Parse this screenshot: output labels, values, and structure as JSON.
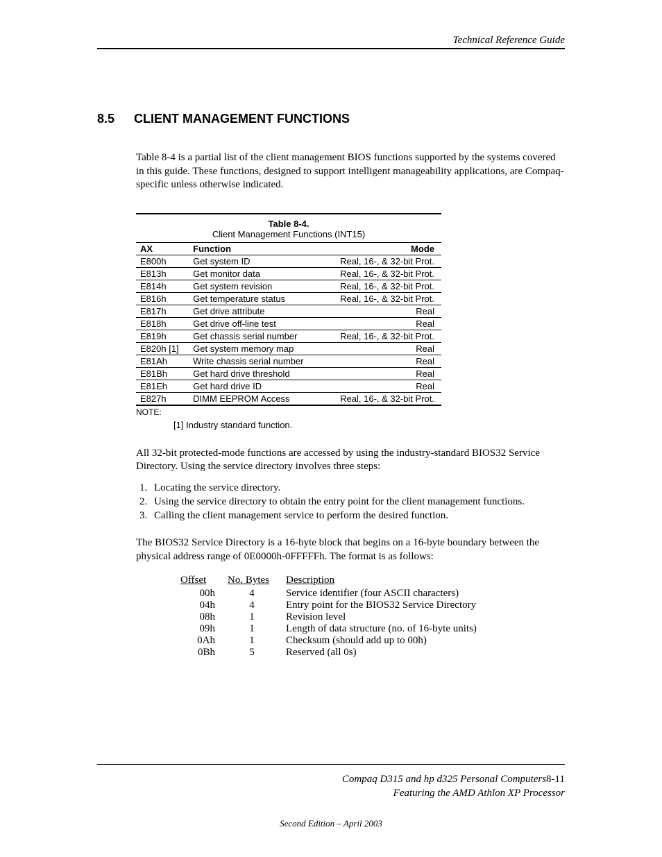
{
  "header": {
    "title": "Technical Reference Guide"
  },
  "section": {
    "number": "8.5",
    "title": "CLIENT MANAGEMENT FUNCTIONS"
  },
  "intro": "Table 8-4 is a partial list of the client management BIOS functions supported by the systems covered in this guide. These functions, designed to support intelligent manageability applications, are Compaq-specific unless otherwise indicated.",
  "table": {
    "label": "Table 8-4.",
    "caption": "Client Management Functions (INT15)",
    "headers": {
      "ax": "AX",
      "function": "Function",
      "mode": "Mode"
    },
    "rows": [
      {
        "ax": "E800h",
        "function": "Get system ID",
        "mode": "Real, 16-, & 32-bit Prot."
      },
      {
        "ax": "E813h",
        "function": "Get monitor data",
        "mode": "Real, 16-, & 32-bit Prot."
      },
      {
        "ax": "E814h",
        "function": "Get system revision",
        "mode": "Real, 16-, & 32-bit Prot."
      },
      {
        "ax": "E816h",
        "function": "Get temperature status",
        "mode": "Real, 16-, & 32-bit Prot."
      },
      {
        "ax": "E817h",
        "function": "Get drive attribute",
        "mode": "Real"
      },
      {
        "ax": "E818h",
        "function": "Get drive off-line test",
        "mode": "Real"
      },
      {
        "ax": "E819h",
        "function": "Get chassis serial number",
        "mode": "Real, 16-, & 32-bit Prot."
      },
      {
        "ax": "E820h [1]",
        "function": "Get system memory map",
        "mode": "Real"
      },
      {
        "ax": "E81Ah",
        "function": "Write chassis serial number",
        "mode": "Real"
      },
      {
        "ax": "E81Bh",
        "function": "Get hard drive threshold",
        "mode": "Real"
      },
      {
        "ax": "E81Eh",
        "function": "Get hard drive ID",
        "mode": "Real"
      },
      {
        "ax": "E827h",
        "function": "DIMM EEPROM Access",
        "mode": "Real, 16-, & 32-bit Prot."
      }
    ],
    "note_label": "NOTE:",
    "note_text": "[1] Industry standard function."
  },
  "para2": "All 32-bit protected-mode functions are accessed by using the industry-standard BIOS32 Service Directory.  Using the service directory involves three steps:",
  "steps": [
    "Locating the service directory.",
    "Using the service directory to obtain the entry point for the client management functions.",
    "Calling the client management service to perform the desired function."
  ],
  "para3": "The BIOS32 Service Directory is a 16-byte block that begins on a 16-byte boundary between the physical address range of 0E0000h-0FFFFFh. The format is as follows:",
  "offset_table": {
    "headers": {
      "offset": "Offset",
      "bytes": "No. Bytes",
      "desc": "Description"
    },
    "rows": [
      {
        "offset": "00h",
        "bytes": "4",
        "desc": "Service identifier (four ASCII characters)"
      },
      {
        "offset": "04h",
        "bytes": "4",
        "desc": "Entry point for the BIOS32 Service Directory"
      },
      {
        "offset": "08h",
        "bytes": "1",
        "desc": "Revision level"
      },
      {
        "offset": "09h",
        "bytes": "1",
        "desc": "Length of data structure (no. of 16-byte units)"
      },
      {
        "offset": "0Ah",
        "bytes": "1",
        "desc": "Checksum (should add up to 00h)"
      },
      {
        "offset": "0Bh",
        "bytes": "5",
        "desc": "Reserved (all 0s)"
      }
    ]
  },
  "footer": {
    "line1a": "Compaq D315 and hp d325 Personal Computers",
    "line1b": "8-11",
    "line2": "Featuring the AMD Athlon XP Processor",
    "edition": "Second Edition – April 2003"
  }
}
